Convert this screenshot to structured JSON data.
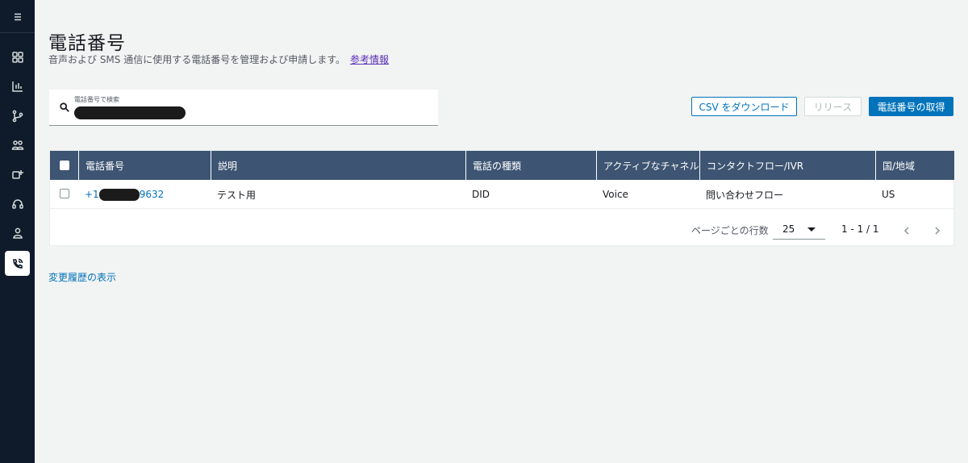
{
  "sidebar": {
    "items": [
      {
        "icon": "menu-icon"
      },
      {
        "icon": "dashboard-icon"
      },
      {
        "icon": "analytics-icon"
      },
      {
        "icon": "routing-icon"
      },
      {
        "icon": "users-icon"
      },
      {
        "icon": "channels-icon"
      },
      {
        "icon": "headset-icon"
      },
      {
        "icon": "user-icon"
      },
      {
        "icon": "phone-number-icon",
        "active": true
      }
    ]
  },
  "header": {
    "title": "電話番号",
    "description": "音声および SMS 通信に使用する電話番号を管理および申請します。",
    "info_link": "参考情報"
  },
  "search": {
    "label": "電話番号で検索"
  },
  "actions": {
    "csv": "CSV をダウンロード",
    "release": "リリース",
    "claim": "電話番号の取得"
  },
  "table": {
    "columns": [
      "電話番号",
      "説明",
      "電話の種類",
      "アクティブなチャネル",
      "コンタクトフロー/IVR",
      "国/地域"
    ],
    "rows": [
      {
        "phone_prefix": "+1",
        "phone_suffix": "9632",
        "description": "テスト用",
        "type": "DID",
        "channel": "Voice",
        "flow": "問い合わせフロー",
        "country": "US"
      }
    ]
  },
  "pagination": {
    "rows_per_page_label": "ページごとの行数",
    "rows_per_page": "25",
    "range": "1 - 1 / 1"
  },
  "footer": {
    "history_link": "変更履歴の表示"
  },
  "colors": {
    "sidebar_bg": "#0f1b2a",
    "table_header": "#3d5472",
    "primary": "#0073bb"
  }
}
